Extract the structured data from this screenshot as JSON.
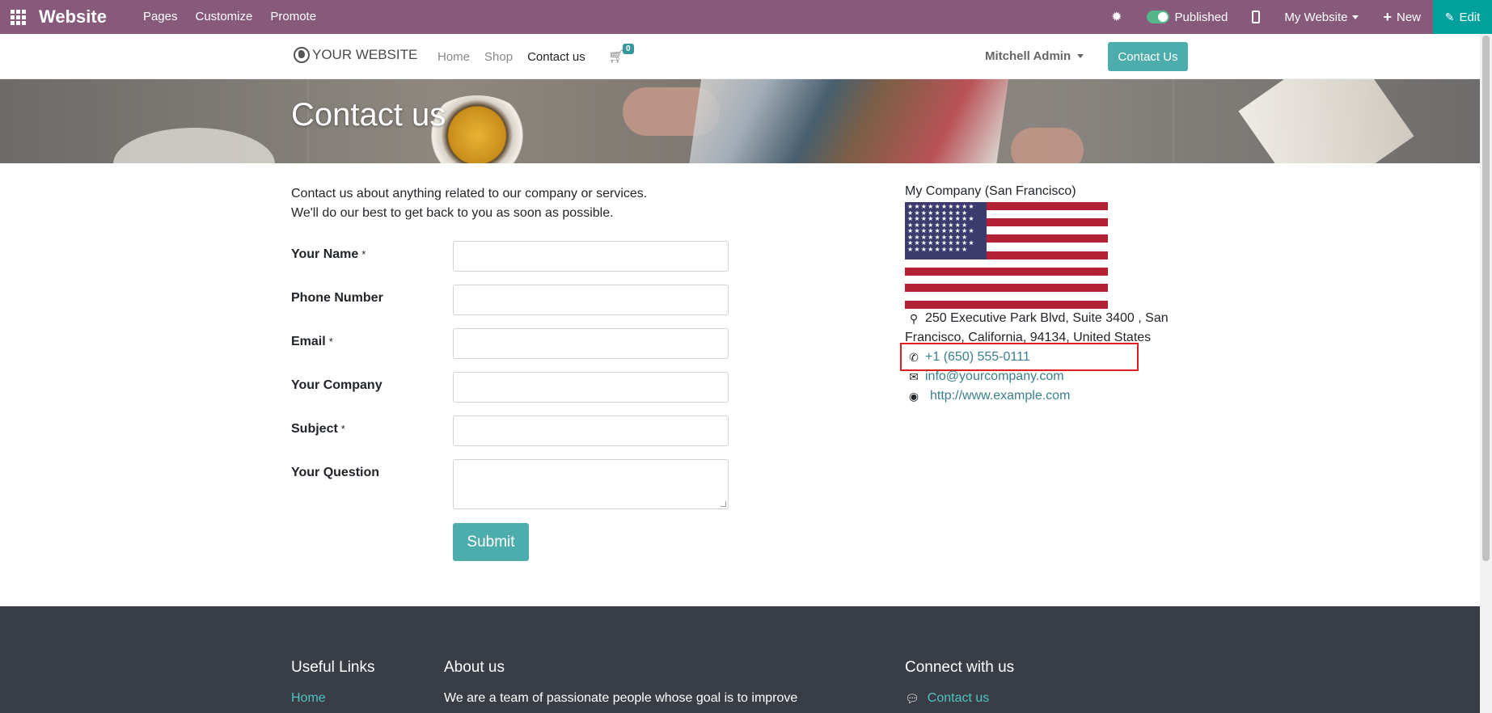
{
  "odoo_bar": {
    "brand": "Website",
    "menu": [
      "Pages",
      "Customize",
      "Promote"
    ],
    "published_label": "Published",
    "website_label": "My Website",
    "new_label": "New",
    "edit_label": "Edit",
    "icons": {
      "apps": "apps-grid-icon",
      "debug": "bug-icon",
      "mobile": "mobile-icon",
      "edit": "pencil-icon"
    }
  },
  "site_header": {
    "logo_text": "YOUR WEBSITE",
    "nav": [
      {
        "label": "Home",
        "active": false
      },
      {
        "label": "Shop",
        "active": false
      },
      {
        "label": "Contact us",
        "active": true
      }
    ],
    "cart_count": "0",
    "user_name": "Mitchell Admin",
    "cta_label": "Contact Us"
  },
  "banner": {
    "title": "Contact us"
  },
  "intro": {
    "line1": "Contact us about anything related to our company or services.",
    "line2": "We'll do our best to get back to you as soon as possible."
  },
  "form": {
    "fields": [
      {
        "label": "Your Name",
        "required": "*",
        "value": ""
      },
      {
        "label": "Phone Number",
        "required": "",
        "value": ""
      },
      {
        "label": "Email",
        "required": "*",
        "value": ""
      },
      {
        "label": "Your Company",
        "required": "",
        "value": ""
      },
      {
        "label": "Subject",
        "required": "*",
        "value": ""
      },
      {
        "label": "Your Question",
        "required": "",
        "value": ""
      }
    ],
    "submit_label": "Submit"
  },
  "company": {
    "name": "My Company (San Francisco)",
    "address_line1": "250 Executive Park Blvd, Suite 3400 , San",
    "address_line2": "Francisco, California, 94134, United States",
    "phone": "+1 (650) 555-0111",
    "email": "info@yourcompany.com",
    "website": "http://www.example.com"
  },
  "footer": {
    "useful_links_title": "Useful Links",
    "useful_links_first": "Home",
    "about_title": "About us",
    "about_text": "We are a team of passionate people whose goal is to improve",
    "connect_title": "Connect with us",
    "connect_first": "Contact us"
  },
  "colors": {
    "odoo_purple": "#875a7b",
    "teal": "#4dadac",
    "footer_bg": "#393e46",
    "highlight": "#e02020"
  }
}
